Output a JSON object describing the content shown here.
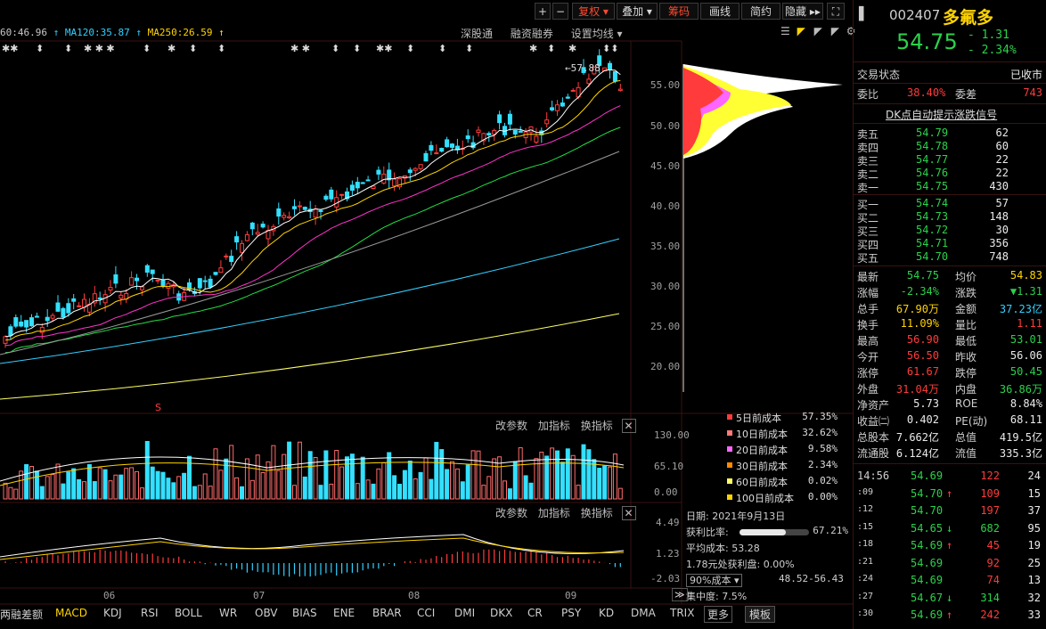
{
  "toolbar": {
    "buttons": [
      "复权",
      "叠加",
      "筹码",
      "画线",
      "简约",
      "隐藏"
    ],
    "plus": "+",
    "minus": "−"
  },
  "ma_labels": [
    {
      "text": "60:46.96",
      "color": "#33d0ff"
    },
    {
      "text": "MA120:35.87",
      "color": "#33d0ff"
    },
    {
      "text": "MA250:26.59",
      "color": "#ffd400"
    }
  ],
  "chart_links": [
    "深股通",
    "融资融券",
    "设置均线"
  ],
  "price_axis": [
    "55.00",
    "50.00",
    "45.00",
    "40.00",
    "35.00",
    "30.00",
    "25.00",
    "20.00"
  ],
  "high_marker": "57.88",
  "month_labels": [
    "06",
    "07",
    "08",
    "09"
  ],
  "panel_buttons": [
    "改参数",
    "加指标",
    "换指标"
  ],
  "volume_axis": [
    "130.00",
    "65.10",
    "0.00"
  ],
  "macd_axis": [
    "4.49",
    "1.23",
    "-2.03"
  ],
  "cost_legend": [
    {
      "label": "5日前成本",
      "value": "57.35%",
      "color": "#ff3b3b"
    },
    {
      "label": "10日前成本",
      "value": "32.62%",
      "color": "#ff7a7a"
    },
    {
      "label": "20日前成本",
      "value": "9.58%",
      "color": "#ff66ff"
    },
    {
      "label": "30日前成本",
      "value": "2.34%",
      "color": "#ff8a00"
    },
    {
      "label": "60日前成本",
      "value": "0.02%",
      "color": "#ffff66"
    },
    {
      "label": "100日前成本",
      "value": "0.00%",
      "color": "#ffd400"
    }
  ],
  "chip_info": {
    "date": "日期: 2021年9月13日",
    "profit_label": "获利比率:",
    "profit_value": "67.21%",
    "profit_ratio": 0.6721,
    "avg_cost": "平均成本: 53.28",
    "within": "1.78元处获利盘: 0.00%",
    "cost_select": "90%成本",
    "cost_range": "48.52-56.43",
    "concentration": "集中度: 7.5%"
  },
  "indicator_tabs": [
    "两融差额",
    "MACD",
    "KDJ",
    "RSI",
    "BOLL",
    "WR",
    "OBV",
    "BIAS",
    "ENE",
    "BRAR",
    "CCI",
    "DMI",
    "DKX",
    "CR",
    "PSY",
    "KD",
    "DMA",
    "TRIX",
    "更多",
    "模板"
  ],
  "stock": {
    "code": "002407",
    "name": "多氟多",
    "price": "54.75",
    "change": "- 1.31",
    "change_pct": "- 2.34%"
  },
  "status": {
    "label": "交易状态",
    "value": "已收市"
  },
  "weibi": {
    "label": "委比",
    "value": "38.40%",
    "label2": "委差",
    "value2": "743"
  },
  "dk_signal": "DK点自动提示涨跌信号",
  "sell_orders": [
    {
      "label": "卖五",
      "price": "54.79",
      "vol": "62"
    },
    {
      "label": "卖四",
      "price": "54.78",
      "vol": "60"
    },
    {
      "label": "卖三",
      "price": "54.77",
      "vol": "22"
    },
    {
      "label": "卖二",
      "price": "54.76",
      "vol": "22"
    },
    {
      "label": "卖一",
      "price": "54.75",
      "vol": "430"
    }
  ],
  "buy_orders": [
    {
      "label": "买一",
      "price": "54.74",
      "vol": "57"
    },
    {
      "label": "买二",
      "price": "54.73",
      "vol": "148"
    },
    {
      "label": "买三",
      "price": "54.72",
      "vol": "30"
    },
    {
      "label": "买四",
      "price": "54.71",
      "vol": "356"
    },
    {
      "label": "买五",
      "price": "54.70",
      "vol": "748"
    }
  ],
  "stats": [
    {
      "l1": "最新",
      "v1": "54.75",
      "c1": "#2bd24b",
      "l2": "均价",
      "v2": "54.83",
      "c2": "#ffd400"
    },
    {
      "l1": "涨幅",
      "v1": "-2.34%",
      "c1": "#2bd24b",
      "l2": "涨跌",
      "v2": "▼1.31",
      "c2": "#2bd24b"
    },
    {
      "l1": "总手",
      "v1": "67.90万",
      "c1": "#ffd400",
      "l2": "金额",
      "v2": "37.23亿",
      "c2": "#33d0ff"
    },
    {
      "l1": "换手",
      "v1": "11.09%",
      "c1": "#ffd400",
      "l2": "量比",
      "v2": "1.11",
      "c2": "#ff3b3b"
    },
    {
      "l1": "最高",
      "v1": "56.90",
      "c1": "#ff3b3b",
      "l2": "最低",
      "v2": "53.01",
      "c2": "#2bd24b"
    },
    {
      "l1": "今开",
      "v1": "56.50",
      "c1": "#ff3b3b",
      "l2": "昨收",
      "v2": "56.06",
      "c2": "#eaeaea"
    },
    {
      "l1": "涨停",
      "v1": "61.67",
      "c1": "#ff3b3b",
      "l2": "跌停",
      "v2": "50.45",
      "c2": "#2bd24b"
    },
    {
      "l1": "外盘",
      "v1": "31.04万",
      "c1": "#ff3b3b",
      "l2": "内盘",
      "v2": "36.86万",
      "c2": "#2bd24b"
    },
    {
      "l1": "净资产",
      "v1": "5.73",
      "c1": "#eaeaea",
      "l2": "ROE",
      "v2": "8.84%",
      "c2": "#eaeaea"
    },
    {
      "l1": "收益㈡",
      "v1": "0.402",
      "c1": "#eaeaea",
      "l2": "PE(动)",
      "v2": "68.11",
      "c2": "#eaeaea"
    },
    {
      "l1": "总股本",
      "v1": "7.662亿",
      "c1": "#eaeaea",
      "l2": "总值",
      "v2": "419.5亿",
      "c2": "#eaeaea"
    },
    {
      "l1": "流通股",
      "v1": "6.124亿",
      "c1": "#eaeaea",
      "l2": "流值",
      "v2": "335.3亿",
      "c2": "#eaeaea"
    }
  ],
  "ticks": [
    {
      "time": "14:56",
      "price": "54.69",
      "arrow": "",
      "vol": "122",
      "n": "24",
      "vc": "#ff3b3b"
    },
    {
      "time": ":09",
      "price": "54.70",
      "arrow": "↑",
      "vol": "109",
      "n": "15",
      "vc": "#ff3b3b"
    },
    {
      "time": ":12",
      "price": "54.70",
      "arrow": "",
      "vol": "197",
      "n": "37",
      "vc": "#ff3b3b"
    },
    {
      "time": ":15",
      "price": "54.65",
      "arrow": "↓",
      "vol": "682",
      "n": "95",
      "vc": "#2bd24b"
    },
    {
      "time": ":18",
      "price": "54.69",
      "arrow": "↑",
      "vol": "45",
      "n": "19",
      "vc": "#ff3b3b"
    },
    {
      "time": ":21",
      "price": "54.69",
      "arrow": "",
      "vol": "92",
      "n": "25",
      "vc": "#ff3b3b"
    },
    {
      "time": ":24",
      "price": "54.69",
      "arrow": "",
      "vol": "74",
      "n": "13",
      "vc": "#ff3b3b"
    },
    {
      "time": ":27",
      "price": "54.67",
      "arrow": "↓",
      "vol": "314",
      "n": "32",
      "vc": "#2bd24b"
    },
    {
      "time": ":30",
      "price": "54.69",
      "arrow": "↑",
      "vol": "242",
      "n": "33",
      "vc": "#ff3b3b"
    }
  ]
}
